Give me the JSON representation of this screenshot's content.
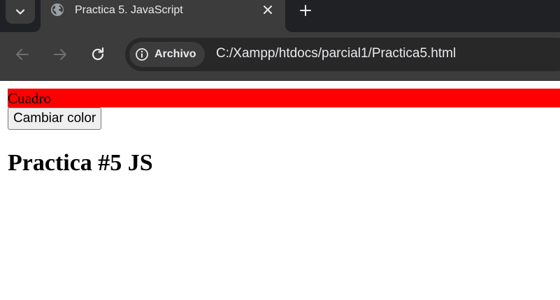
{
  "browser": {
    "tab": {
      "title": "Practica 5. JavaScript"
    },
    "site_chip_label": "Archivo",
    "url": "C:/Xampp/htdocs/parcial1/Practica5.html",
    "icons": {
      "tab_search": "chevron-down-icon",
      "favicon": "globe-icon",
      "close": "close-icon",
      "new_tab": "plus-icon",
      "back": "arrow-left-icon",
      "forward": "arrow-right-icon",
      "reload": "reload-icon",
      "info": "info-icon"
    },
    "colors": {
      "chrome_dark": "#202124",
      "tab_active": "#3c3c3c",
      "omnibox": "#282828",
      "text": "#e8eaed"
    }
  },
  "page": {
    "cuadro": {
      "text": "Cuadro",
      "background": "#ff0000"
    },
    "button_label": "Cambiar color",
    "heading": "Practica #5 JS"
  }
}
